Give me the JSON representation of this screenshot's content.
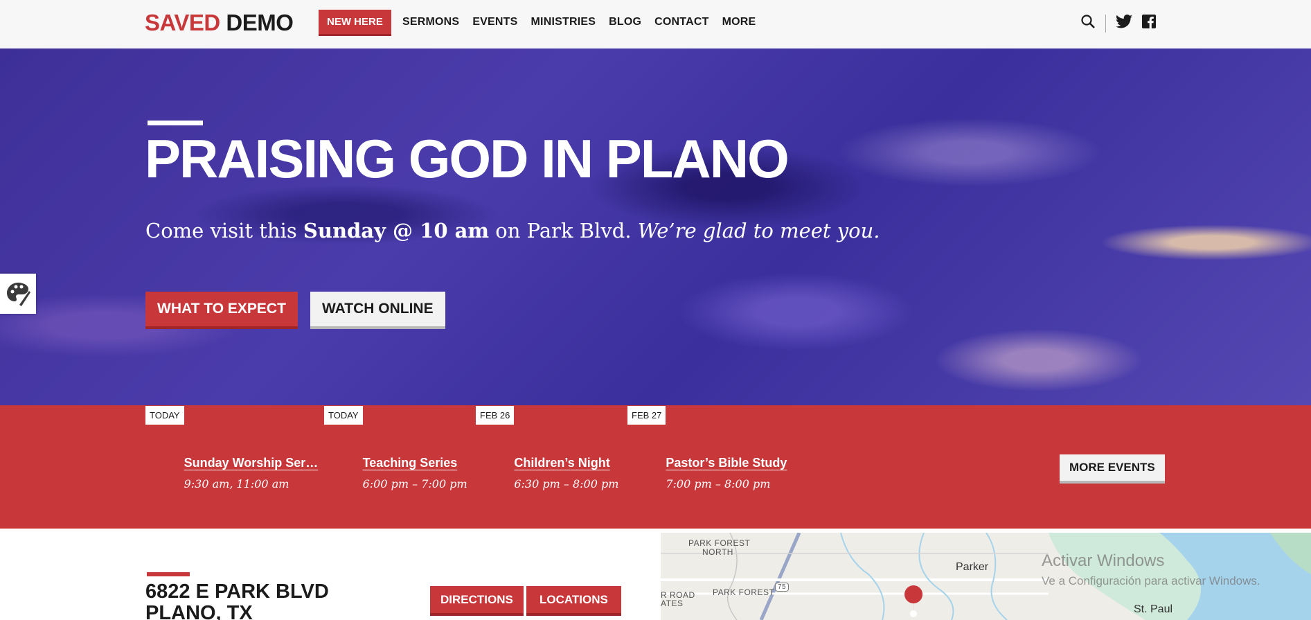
{
  "header": {
    "logo_part1": "SAVED",
    "logo_part2": "DEMO",
    "new_here": "NEW HERE",
    "nav": [
      "SERMONS",
      "EVENTS",
      "MINISTRIES",
      "BLOG",
      "CONTACT",
      "MORE"
    ],
    "icons": [
      "search-icon",
      "twitter-icon",
      "facebook-icon"
    ]
  },
  "hero": {
    "title": "PRAISING GOD IN PLANO",
    "sub_1": "Come visit this ",
    "sub_bold": "Sunday @ 10 am",
    "sub_2": " on Park Blvd. ",
    "sub_italic": "We’re glad to meet you.",
    "btn_expect": "WHAT TO EXPECT",
    "btn_watch": "WATCH ONLINE"
  },
  "events": {
    "items": [
      {
        "date": "TODAY",
        "title": "Sunday Worship Ser…",
        "time": "9:30 am, 11:00 am"
      },
      {
        "date": "TODAY",
        "title": "Teaching Series",
        "time": "6:00 pm – 7:00 pm"
      },
      {
        "date": "FEB 26",
        "title": "Children’s Night",
        "time": "6:30 pm – 8:00 pm"
      },
      {
        "date": "FEB 27",
        "title": "Pastor’s Bible Study",
        "time": "7:00 pm – 8:00 pm"
      }
    ],
    "more": "MORE EVENTS"
  },
  "location": {
    "line1": "6822 E PARK BLVD",
    "line2": "PLANO, TX",
    "directions": "DIRECTIONS",
    "locations": "LOCATIONS"
  },
  "map": {
    "labels": [
      "PARK FOREST",
      "NORTH",
      "PARK FOREST",
      "R ROAD",
      "ATES",
      "75"
    ],
    "cities": [
      "Parker",
      "St. Paul"
    ],
    "watermark_1": "Activar Windows",
    "watermark_2": "Ve a Configuración para activar Windows."
  },
  "colors": {
    "accent": "#c8373a",
    "dark": "#1b1b1b",
    "hero": "#3e2f98"
  }
}
